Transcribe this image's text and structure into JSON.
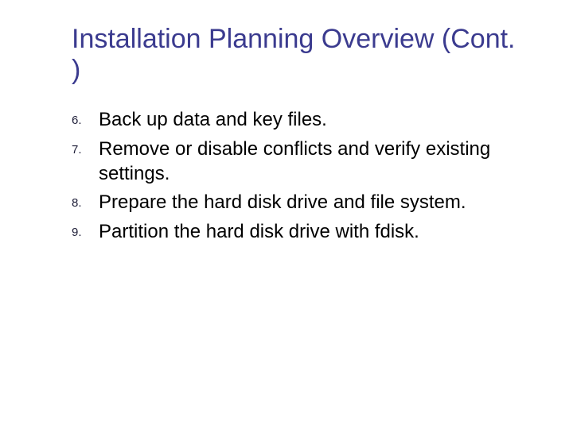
{
  "title": "Installation Planning Overview (Cont. )",
  "items": [
    {
      "num": "6.",
      "text": "Back up data and key files."
    },
    {
      "num": "7.",
      "text": "Remove or disable conflicts and verify existing settings."
    },
    {
      "num": "8.",
      "text": "Prepare the hard disk drive and file system."
    },
    {
      "num": "9.",
      "text": "Partition the hard disk drive with fdisk."
    }
  ]
}
